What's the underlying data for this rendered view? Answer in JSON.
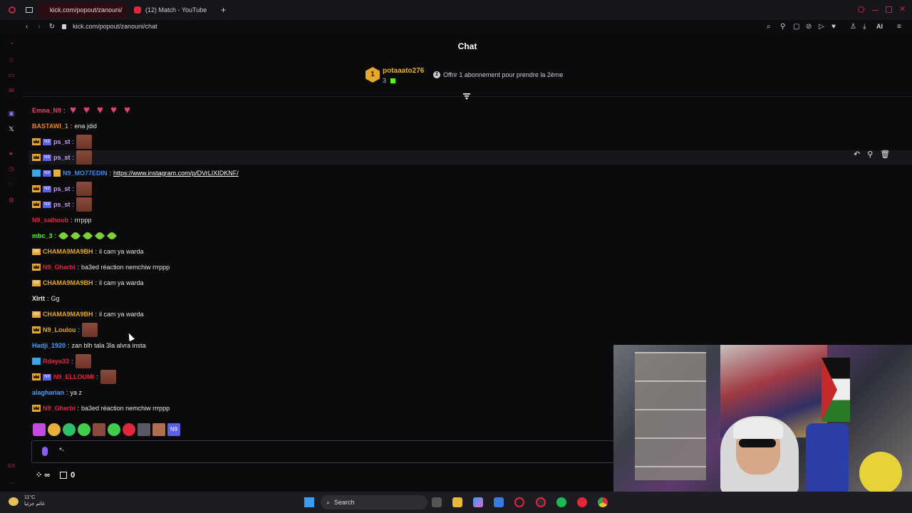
{
  "browser": {
    "tabs": [
      {
        "title": "kick.com/popout/zanouni/",
        "active": true
      },
      {
        "title": "(12) Match - YouTube",
        "active": false
      }
    ],
    "address": "kick.com/popout/zanouni/chat",
    "ai_label": "AI"
  },
  "chat": {
    "title": "Chat",
    "pinned": {
      "rank": "1",
      "username": "potaaato276",
      "count": "3",
      "offer_number": "2",
      "offer_text": "Offrir 1 abonnement pour prendre la 2ème"
    },
    "messages": [
      {
        "user": "Emna_N9",
        "color": "#e6436a",
        "text": ""
      },
      {
        "user": "BASTAWI_1",
        "color": "#e8852a",
        "text": "ena jdid"
      },
      {
        "user": "ps_st",
        "color": "#c9a0f0",
        "text": ""
      },
      {
        "user": "ps_st",
        "color": "#c9a0f0",
        "text": ""
      },
      {
        "user": "N9_MO77EDIN",
        "color": "#3a8cf0",
        "text": "https://www.instagram.com/p/DVrLIXIDKNF/"
      },
      {
        "user": "ps_st",
        "color": "#c9a0f0",
        "text": ""
      },
      {
        "user": "ps_st",
        "color": "#c9a0f0",
        "text": ""
      },
      {
        "user": "N9_salhoub",
        "color": "#e0283c",
        "text": "rrrppp"
      },
      {
        "user": "mbc_3",
        "color": "#53fc18",
        "text": ""
      },
      {
        "user": "CHAMA9MA9BH",
        "color": "#e5a82a",
        "text": "il cam ya warda"
      },
      {
        "user": "N9_Gharbi",
        "color": "#e0283c",
        "text": "ba3ed réaction nemchiw rrrppp"
      },
      {
        "user": "CHAMA9MA9BH",
        "color": "#e5a82a",
        "text": "il cam ya warda"
      },
      {
        "user": "Xlrtt",
        "color": "#f0f0f0",
        "text": "Gg"
      },
      {
        "user": "CHAMA9MA9BH",
        "color": "#e5a82a",
        "text": "il cam ya warda"
      },
      {
        "user": "N9_Loulou",
        "color": "#e5a82a",
        "text": ""
      },
      {
        "user": "Hadji_1920",
        "color": "#4aa0f0",
        "text": "zan blh tala 3la alvra insta"
      },
      {
        "user": "Rdaya33",
        "color": "#e0283c",
        "text": ""
      },
      {
        "user": "N9_ELLOUMI",
        "color": "#e0283c",
        "text": ""
      },
      {
        "user": "alagharian",
        "color": "#4aa0f0",
        "text": "ya z"
      },
      {
        "user": "N9_Gharbi",
        "color": "#e0283c",
        "text": "ba3ed réaction nemchiw rrrppp"
      }
    ],
    "input_value": "*-",
    "bottom": {
      "infinity": "∞",
      "gift_count": "0"
    }
  },
  "taskbar": {
    "temperature": "11°C",
    "weather_text": "غائم جزئيا",
    "search": "Search"
  },
  "colors": {
    "accent": "#53fc18",
    "kick_red": "#c0283d",
    "gold": "#e5a82a"
  }
}
